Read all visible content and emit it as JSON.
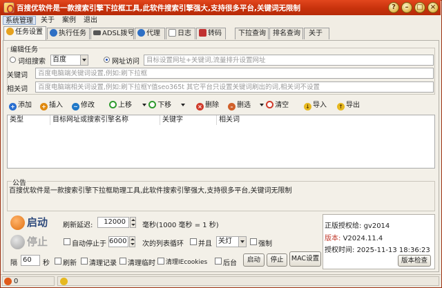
{
  "window": {
    "title": "百搜优软件是一款搜索引擎下拉框工具,此软件搜索引擎强大,支持很多平台,关键词无限制",
    "controls": [
      "?",
      "–",
      "□",
      "×"
    ]
  },
  "menu": [
    "系统管理",
    "关于",
    "案例",
    "退出"
  ],
  "tabs": [
    {
      "label": "任务设置",
      "icon": "gear-icon",
      "color": "#d98b00"
    },
    {
      "label": "执行任务",
      "icon": "globe-icon",
      "color": "#2e6fc4"
    },
    {
      "label": "ADSL拨号",
      "icon": "adsl-icon",
      "color": "#4b4b4b"
    },
    {
      "label": "代理",
      "icon": "globe-icon",
      "color": "#2e6fc4"
    },
    {
      "label": "日志",
      "icon": "notepad-icon",
      "color": "#7a7a7a"
    },
    {
      "label": "转码",
      "icon": "tools-icon",
      "color": "#c03030"
    },
    {
      "label": "下拉查询",
      "icon": "",
      "color": ""
    },
    {
      "label": "排名查询",
      "icon": "",
      "color": ""
    },
    {
      "label": "关于",
      "icon": "",
      "color": ""
    }
  ],
  "edit_task": {
    "group_label": "编辑任务",
    "radio_engine_label": "词组搜索",
    "engine_value": "百度",
    "radio_url_label": "网址访问",
    "url_placeholder": "目标设置网址+关键词,流量排升设置网址",
    "keyword_label": "关键词",
    "keyword_placeholder": "百度电脑端关键词设置,例如:刷下拉框",
    "related_label": "相关词",
    "related_placeholder": "百度电脑端相关词设置,例如:刷下拉框Y值seo365t 其它平台只设置关键词刷出的词,相关词不设置"
  },
  "toolbar": {
    "add": "添加",
    "insert": "插入",
    "modify": "修改",
    "up": "上移",
    "down": "下移",
    "delete": "删除",
    "select": "删选",
    "clear": "清空",
    "import": "导入",
    "export": "导出"
  },
  "table": {
    "columns": [
      "类型",
      "目标网址或搜索引擎名称",
      "关键字",
      "相关词"
    ],
    "rows": []
  },
  "notice": {
    "label": "公告",
    "text": "百搜优软件是一款搜索引擎下拉框助理工具,此软件搜索引擎强大,支持很多平台,关键词无限制"
  },
  "controls": {
    "start_label": "启动",
    "stop_label": "停止",
    "delay_label": "刷新延迟:",
    "delay_value": "12000",
    "delay_unit": "毫秒(1000 毫秒 = 1 秒)",
    "auto_stop_label": "自动停止于",
    "auto_stop_value": "6000",
    "auto_stop_unit": "次的列表循环",
    "parallel_label": "并且",
    "shutdown_value": "关灯",
    "force_label": "强制",
    "interval_label": "隔",
    "interval_value": "60",
    "interval_unit": "秒",
    "refresh_label": "刷新",
    "clear_records_label": "清理记录",
    "clear_temp_label": "清理临时",
    "clear_cookies_label": "清理IEcookies",
    "background_label": "后台",
    "start_small": "启动",
    "stop_small": "停止",
    "mac_button": "MAC设置"
  },
  "license": {
    "line1_label": "正版授权给:",
    "line1_value": "gv2014",
    "line2_label": "版本:",
    "line2_value": "V2024.11.4",
    "line3_label": "授权时间:",
    "line3_value": "2025-11-13 18:36:23",
    "check_button": "版本检查"
  },
  "status": {
    "left_value": "0",
    "accent": "#d24a1a"
  }
}
